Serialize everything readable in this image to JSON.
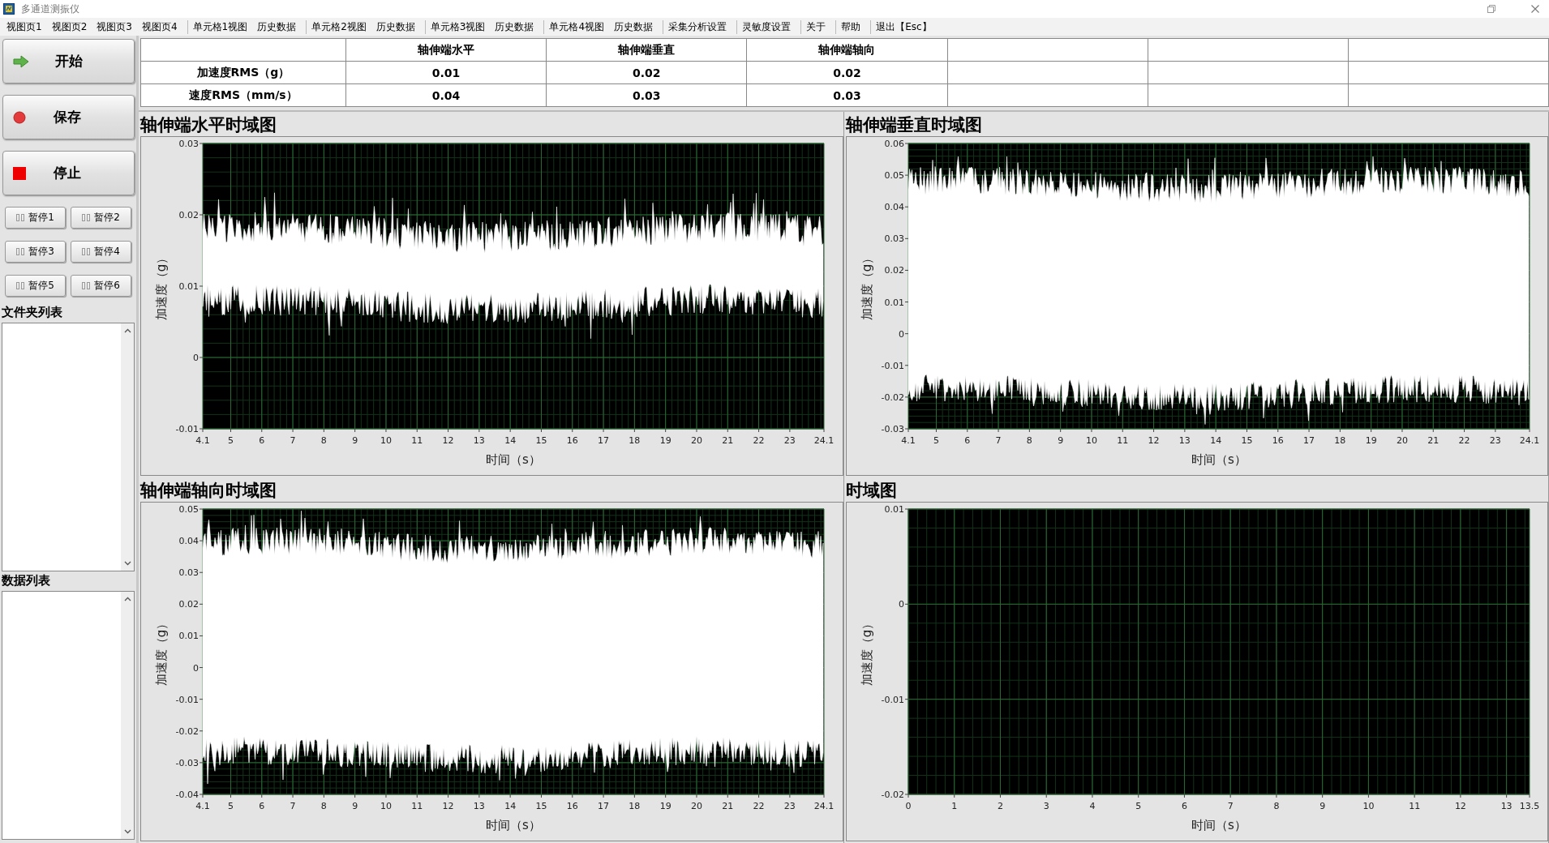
{
  "window": {
    "title": "多通道测振仪"
  },
  "menu": [
    [
      "视图页1",
      "视图页2",
      "视图页3",
      "视图页4"
    ],
    [
      "单元格1视图",
      "历史数据"
    ],
    [
      "单元格2视图",
      "历史数据"
    ],
    [
      "单元格3视图",
      "历史数据"
    ],
    [
      "单元格4视图",
      "历史数据"
    ],
    [
      "采集分析设置"
    ],
    [
      "灵敏度设置"
    ],
    [
      "关于"
    ],
    [
      "帮助"
    ],
    [
      "退出【Esc】"
    ]
  ],
  "controls": {
    "main_buttons": [
      {
        "label": "开始",
        "kind": "start"
      },
      {
        "label": "保存",
        "kind": "save"
      },
      {
        "label": "停止",
        "kind": "stop"
      }
    ],
    "pause_buttons": [
      "暂停1",
      "暂停2",
      "暂停3",
      "暂停4",
      "暂停5",
      "暂停6"
    ],
    "lists": [
      {
        "title": "文件夹列表"
      },
      {
        "title": "数据列表"
      }
    ]
  },
  "table": {
    "columns": [
      "轴伸端水平",
      "轴伸端垂直",
      "轴伸端轴向"
    ],
    "rows": [
      {
        "label": "加速度RMS（g）",
        "values": [
          "0.01",
          "0.02",
          "0.02"
        ]
      },
      {
        "label": "速度RMS（mm/s）",
        "values": [
          "0.04",
          "0.03",
          "0.03"
        ]
      }
    ]
  },
  "charts": [
    {
      "title": "轴伸端水平时域图",
      "kind": "waveform",
      "ylabel": "加速度（g）",
      "xlabel": "时间（s）",
      "yticks": [
        "0.03",
        "0.02",
        "0.01",
        "0",
        "-0.01"
      ],
      "xticks": [
        "4.1",
        "5",
        "6",
        "7",
        "8",
        "9",
        "10",
        "11",
        "12",
        "13",
        "14",
        "15",
        "16",
        "17",
        "18",
        "19",
        "20",
        "21",
        "22",
        "23",
        "24.1"
      ]
    },
    {
      "title": "轴伸端垂直时域图",
      "kind": "waveform",
      "ylabel": "加速度（g）",
      "xlabel": "时间（s）",
      "yticks": [
        "0.06",
        "0.05",
        "0.04",
        "0.03",
        "0.02",
        "0.01",
        "0",
        "-0.01",
        "-0.02",
        "-0.03"
      ],
      "xticks": [
        "4.1",
        "5",
        "6",
        "7",
        "8",
        "9",
        "10",
        "11",
        "12",
        "13",
        "14",
        "15",
        "16",
        "17",
        "18",
        "19",
        "20",
        "21",
        "22",
        "23",
        "24.1"
      ]
    },
    {
      "title": "轴伸端轴向时域图",
      "kind": "waveform",
      "ylabel": "加速度（g）",
      "xlabel": "时间（s）",
      "yticks": [
        "0.05",
        "0.04",
        "0.03",
        "0.02",
        "0.01",
        "0",
        "-0.01",
        "-0.02",
        "-0.03",
        "-0.04"
      ],
      "xticks": [
        "4.1",
        "5",
        "6",
        "7",
        "8",
        "9",
        "10",
        "11",
        "12",
        "13",
        "14",
        "15",
        "16",
        "17",
        "18",
        "19",
        "20",
        "21",
        "22",
        "23",
        "24.1"
      ]
    },
    {
      "title": "时域图",
      "kind": "empty",
      "ylabel": "加速度（g）",
      "xlabel": "时间（s）",
      "yticks": [
        "0.01",
        "0",
        "-0.01",
        "-0.02"
      ],
      "xticks": [
        "0",
        "1",
        "2",
        "3",
        "4",
        "5",
        "6",
        "7",
        "8",
        "9",
        "10",
        "11",
        "12",
        "13",
        "13.5"
      ]
    }
  ]
}
